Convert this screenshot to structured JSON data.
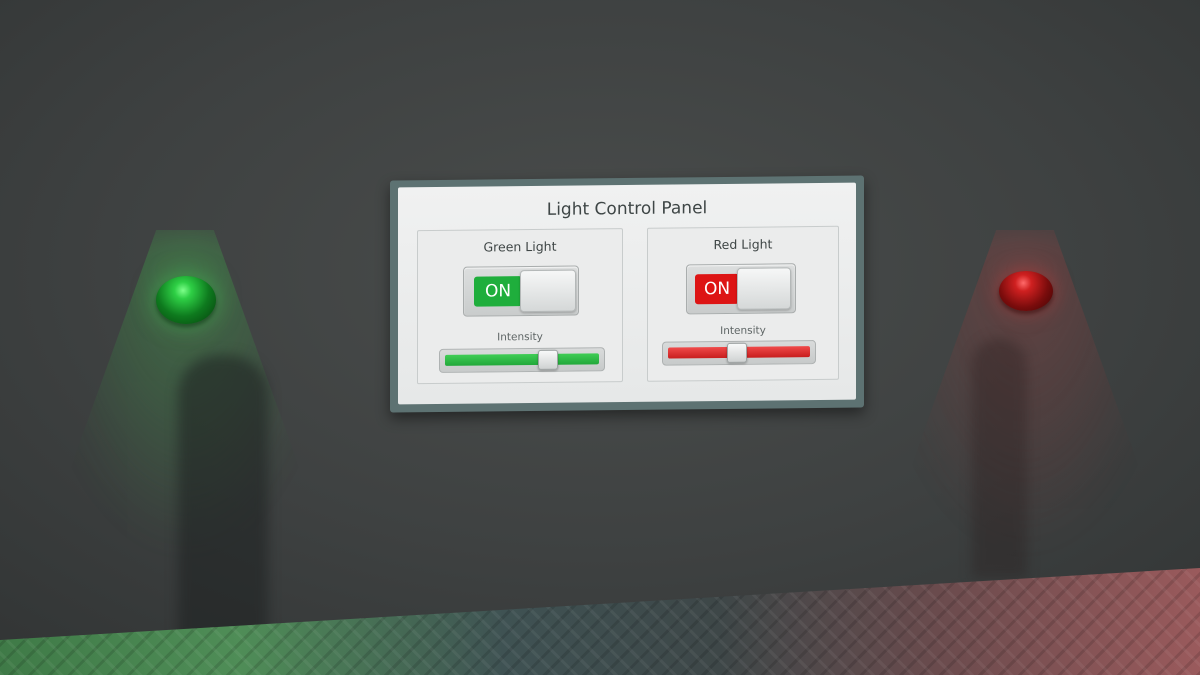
{
  "panel": {
    "title": "Light Control Panel"
  },
  "lights": [
    {
      "name": "Green Light",
      "toggle_label": "ON",
      "state": "on",
      "intensity_label": "Intensity",
      "intensity": 0.66,
      "color": "#1fae3c"
    },
    {
      "name": "Red Light",
      "toggle_label": "ON",
      "state": "on",
      "intensity_label": "Intensity",
      "intensity": 0.48,
      "color": "#dd1414"
    }
  ]
}
